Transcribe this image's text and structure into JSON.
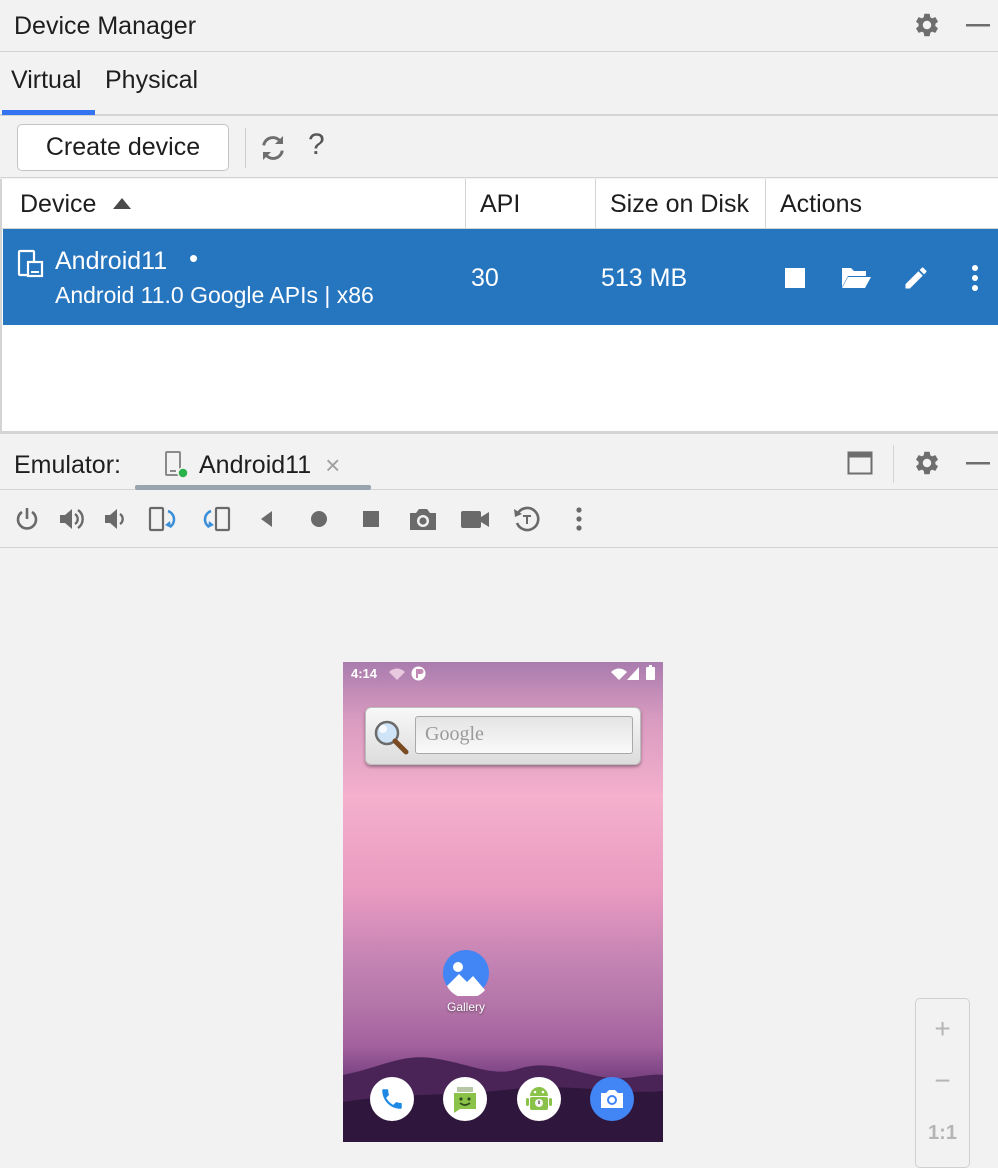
{
  "device_manager": {
    "title": "Device Manager",
    "settings_icon": "gear-icon",
    "minimize_icon": "minimize-icon"
  },
  "tabs": [
    {
      "label": "Virtual",
      "selected": true
    },
    {
      "label": "Physical",
      "selected": false
    }
  ],
  "toolbar": {
    "create_label": "Create device",
    "refresh_icon": "refresh-icon",
    "help_label": "?"
  },
  "table": {
    "columns": [
      "Device",
      "API",
      "Size on Disk",
      "Actions"
    ],
    "sort_column": "Device",
    "sort_direction": "ascending",
    "rows": [
      {
        "name": "Android11",
        "running_indicator": "•",
        "description": "Android 11.0 Google APIs | x86",
        "api": "30",
        "size": "513 MB",
        "actions": [
          "stop-icon",
          "folder-open-icon",
          "edit-icon",
          "more-vert-icon"
        ],
        "selected": true
      }
    ]
  },
  "emulator": {
    "label": "Emulator:",
    "tab_name": "Android11",
    "close_glyph": "×",
    "toolbar_icons": [
      "power-icon",
      "volume-up-icon",
      "volume-down-icon",
      "rotate-left-icon",
      "rotate-right-icon",
      "back-icon",
      "home-icon",
      "overview-icon",
      "screenshot-icon",
      "screen-record-icon",
      "snapshot-icon",
      "more-vert-icon"
    ]
  },
  "phone": {
    "time": "4:14",
    "search_placeholder": "Google",
    "apps": [
      {
        "label": "Gallery",
        "icon": "gallery-icon"
      }
    ],
    "dock": [
      "phone-icon",
      "messaging-icon",
      "android-icon",
      "camera-icon"
    ]
  },
  "zoom": {
    "zoom_in": "+",
    "zoom_out": "−",
    "actual_size": "1:1"
  },
  "colors": {
    "accent": "#3574f0",
    "selection": "#2675bf",
    "background": "#f2f2f2"
  }
}
